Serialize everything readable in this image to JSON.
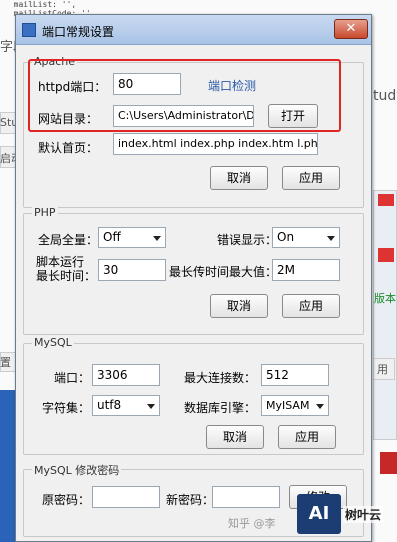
{
  "background": {
    "code_lines": "  mailList: '',\n  mailListCode: '',",
    "left_text_1": "字段",
    "left_text_2": "Stu",
    "left_text_3": "启动",
    "left_text_4": "置",
    "right_text_1": "tudy",
    "right_text_2": "版本",
    "right_text_3": "用"
  },
  "window": {
    "title": "端口常规设置",
    "close_label": "✕"
  },
  "apache": {
    "group_label": "Apache",
    "port_label": "httpd端口：",
    "port_value": "80",
    "port_check_link": "端口检测",
    "docroot_label": "网站目录：",
    "docroot_value": "C:\\Users\\Administrator\\Desktop",
    "open_button": "打开",
    "index_label": "默认首页：",
    "index_value": "index.html index.php index.htm l.php",
    "cancel_button": "取消",
    "apply_button": "应用"
  },
  "php": {
    "group_label": "PHP",
    "global_label": "全局全量：",
    "global_value": "Off",
    "error_label": "错误显示：",
    "error_value": "On",
    "runtime_label_1": "脚本运行",
    "runtime_label_2": "最长时间：",
    "runtime_value": "30",
    "upload_label": "最长传时间最大值：",
    "upload_value": "2M",
    "cancel_button": "取消",
    "apply_button": "应用"
  },
  "mysql": {
    "group_label": "MySQL",
    "port_label": "端口：",
    "port_value": "3306",
    "maxconn_label": "最大连接数：",
    "maxconn_value": "512",
    "charset_label": "字符集：",
    "charset_value": "utf8",
    "engine_label": "数据库引擎：",
    "engine_value": "MyISAM",
    "cancel_button": "取消",
    "apply_button": "应用"
  },
  "mysql_password": {
    "group_label": "MySQL 修改密码",
    "old_label": "原密码：",
    "new_label": "新密码：",
    "modify_button": "修改"
  },
  "watermark": {
    "zhihu": "知乎 @李",
    "logo_text": "AI",
    "brand": "树叶云"
  }
}
